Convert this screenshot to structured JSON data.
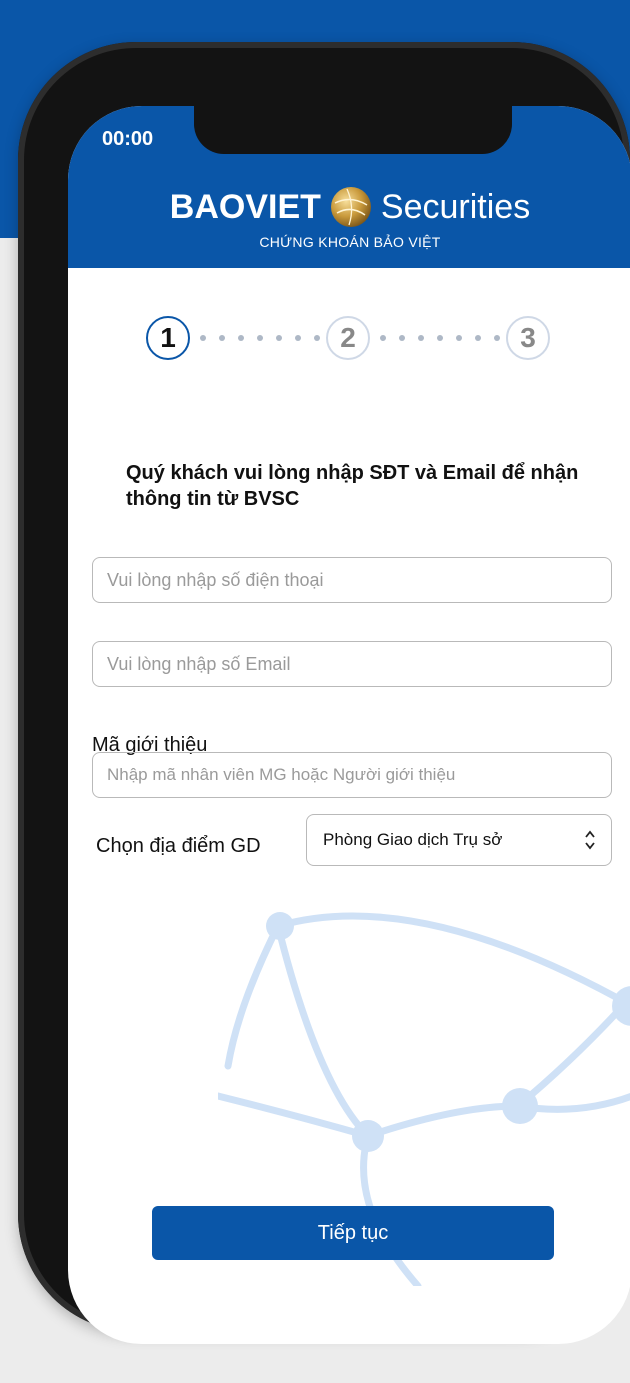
{
  "status_bar": {
    "time": "00:00"
  },
  "brand": {
    "name_left": "BAOVIET",
    "name_right": "Securities",
    "subtitle": "CHỨNG KHOÁN BẢO VIỆT",
    "globe_icon": "globe-logo-icon"
  },
  "steps": [
    {
      "label": "1",
      "state": "active"
    },
    {
      "label": "2",
      "state": "inactive"
    },
    {
      "label": "3",
      "state": "inactive"
    }
  ],
  "form": {
    "intro": "Quý khách vui lòng nhập SĐT và Email để nhận thông tin từ BVSC",
    "phone_placeholder": "Vui lòng nhập số điện thoại",
    "email_placeholder": "Vui lòng nhập số Email",
    "referral_label": "Mã giới thiệu",
    "referral_placeholder": "Nhập mã nhân viên MG hoặc Người giới thiệu",
    "location_label": "Chọn địa điểm GD",
    "location_value": "Phòng Giao dịch Trụ sở",
    "location_icon": "updown-chevron-icon"
  },
  "actions": {
    "continue_label": "Tiếp tục"
  },
  "colors": {
    "primary": "#0a56a8",
    "background": "#ececec",
    "phone_frame": "#131313",
    "globe_bg": "#cfe1f6"
  }
}
